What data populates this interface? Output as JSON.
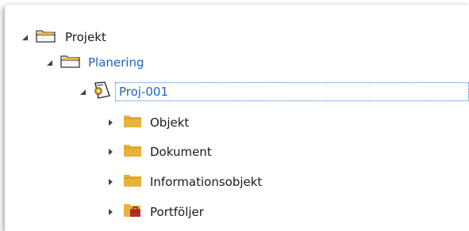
{
  "tree": {
    "nodes": [
      {
        "label": "Projekt",
        "icon": "folder-open-icon",
        "expanded": true
      },
      {
        "label": "Planering",
        "icon": "folder-open-icon",
        "expanded": true
      },
      {
        "label": "Proj-001",
        "icon": "project-document-icon",
        "expanded": true,
        "selected": true
      },
      {
        "label": "Objekt",
        "icon": "folder-icon",
        "expanded": false
      },
      {
        "label": "Dokument",
        "icon": "folder-icon",
        "expanded": false
      },
      {
        "label": "Informationsobjekt",
        "icon": "folder-icon",
        "expanded": false
      },
      {
        "label": "Portföljer",
        "icon": "portfolio-icon",
        "expanded": false
      }
    ]
  },
  "colors": {
    "link": "#1d63c8",
    "folder": "#e8b33a",
    "selection_border": "#2a7be0",
    "portfolio": "#b2322a"
  }
}
